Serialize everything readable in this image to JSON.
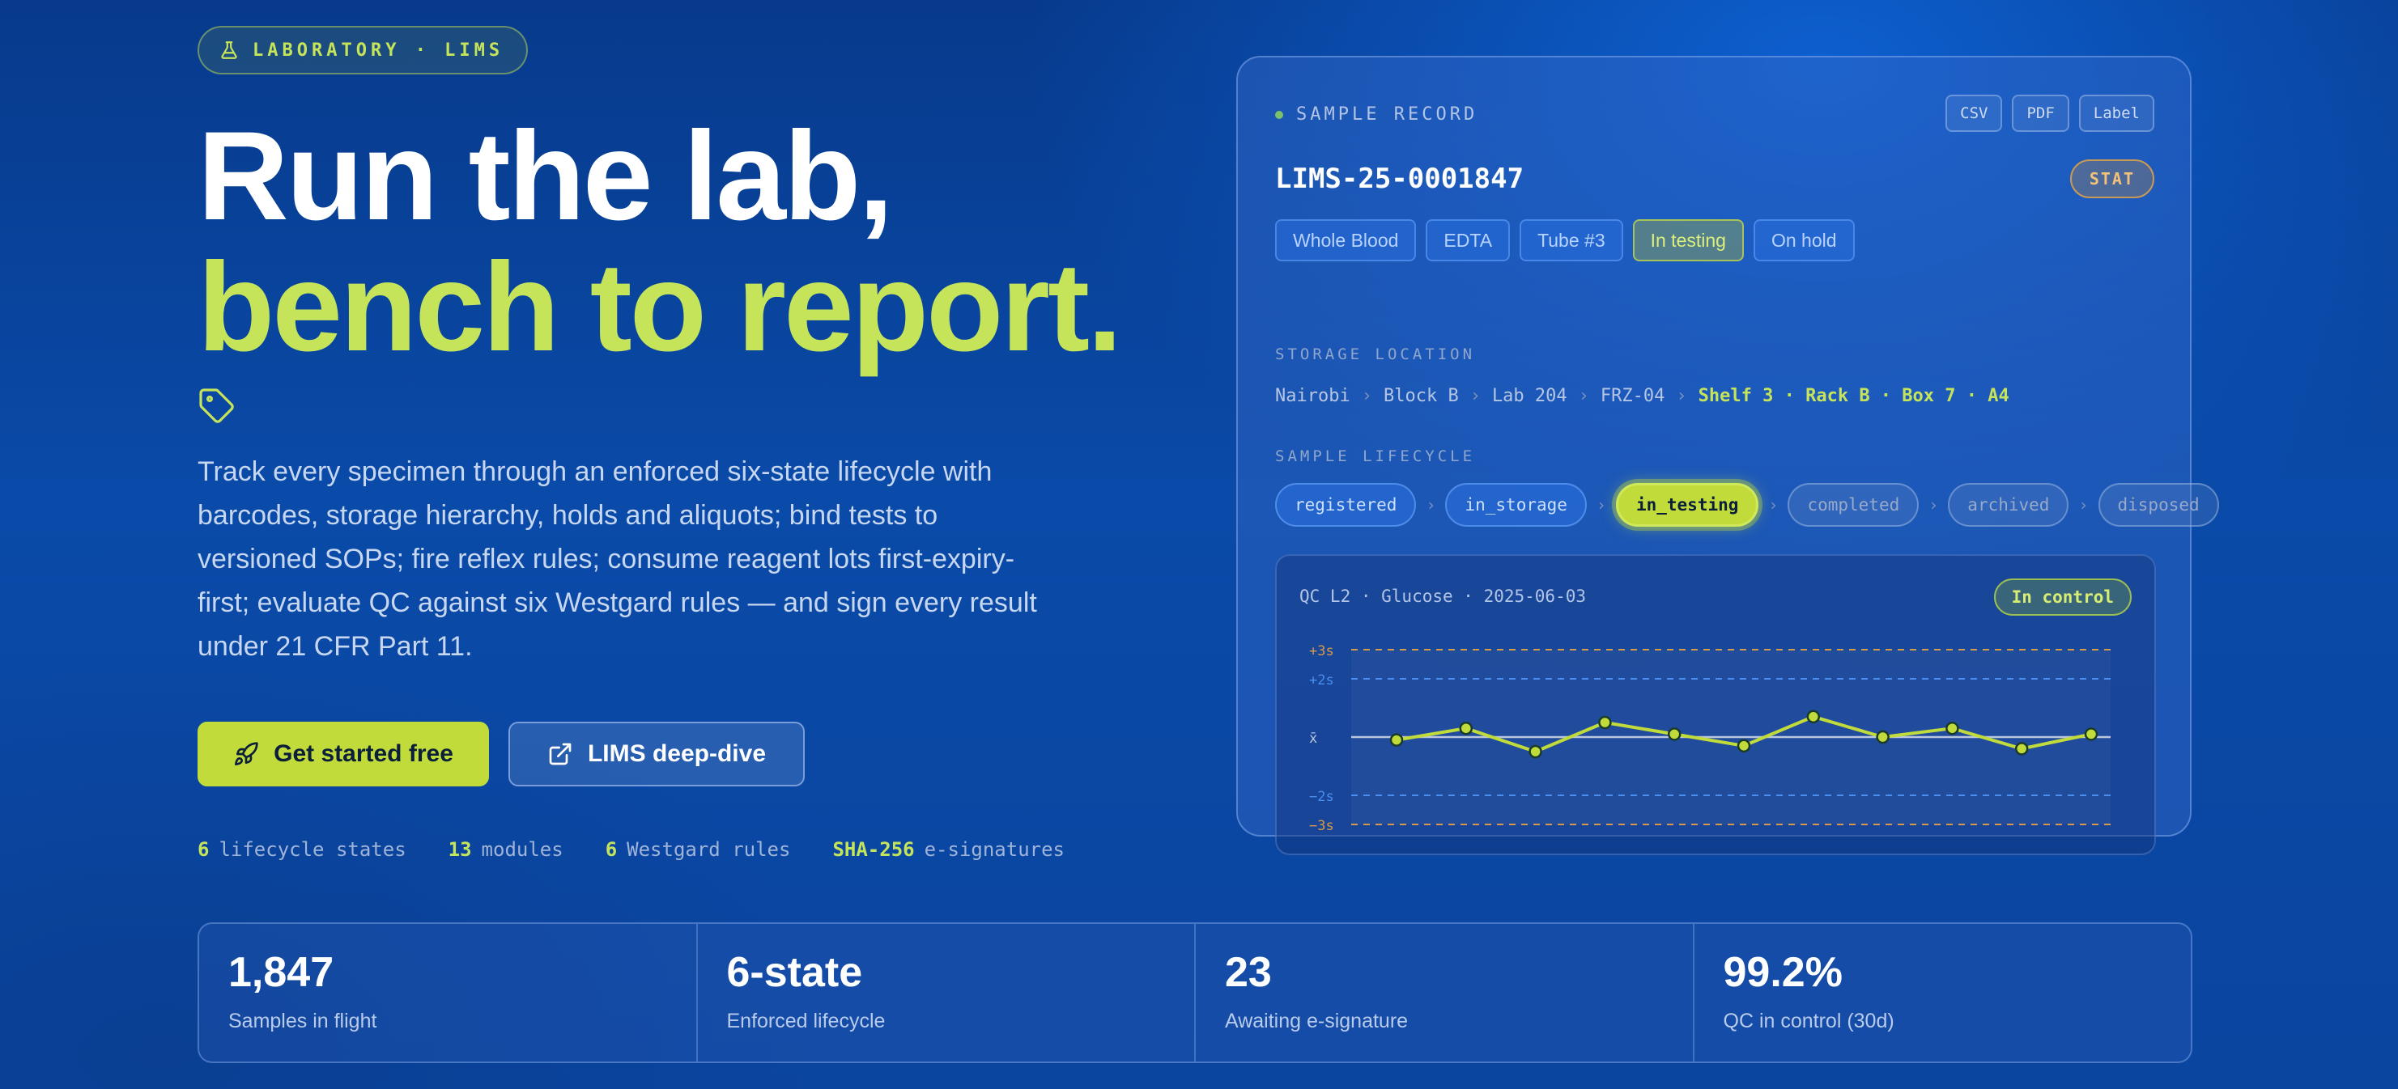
{
  "eyebrow": {
    "text": "LABORATORY · LIMS",
    "icon": "flask-icon"
  },
  "hero": {
    "line1": "Run the lab,",
    "line2": "bench to report."
  },
  "lead": "Track every specimen through an enforced six-state lifecycle with barcodes, storage hierarchy, holds and aliquots; bind tests to versioned SOPs; fire reflex rules; consume reagent lots first-expiry-first; evaluate QC against six Westgard rules — and sign every result under 21 CFR Part 11.",
  "buttons": {
    "primary": "Get started free",
    "secondary": "LIMS deep-dive"
  },
  "facts": [
    {
      "n": "6",
      "t": "lifecycle states"
    },
    {
      "n": "13",
      "t": "modules"
    },
    {
      "n": "6",
      "t": "Westgard rules"
    },
    {
      "n": "SHA-256",
      "t": "e-signatures"
    }
  ],
  "stats": [
    {
      "v": "1,847",
      "l": "Samples in flight"
    },
    {
      "v": "6-state",
      "l": "Enforced lifecycle"
    },
    {
      "v": "23",
      "l": "Awaiting e-signature"
    },
    {
      "v": "99.2%",
      "l": "QC in control (30d)"
    }
  ],
  "card": {
    "header": "SAMPLE RECORD",
    "actions": [
      "CSV",
      "PDF",
      "Label"
    ],
    "sample_id": "LIMS-25-0001847",
    "priority": "STAT",
    "chips": [
      "Whole Blood",
      "EDTA",
      "Tube #3",
      "In testing",
      "On hold"
    ],
    "storage_label": "STORAGE LOCATION",
    "storage": [
      "Nairobi",
      "Block B",
      "Lab 204",
      "FRZ-04"
    ],
    "storage_detail": "Shelf 3 · Rack B · Box 7 · A4",
    "lifecycle_label": "SAMPLE LIFECYCLE",
    "lifecycle": [
      {
        "s": "registered",
        "state": "done"
      },
      {
        "s": "in_storage",
        "state": "done"
      },
      {
        "s": "in_testing",
        "state": "cur"
      },
      {
        "s": "completed",
        "state": "todo"
      },
      {
        "s": "archived",
        "state": "todo"
      },
      {
        "s": "disposed",
        "state": "todo"
      }
    ],
    "qc_title": "QC L2 · Glucose · 2025-06-03",
    "qc_status": "In control"
  },
  "colors": {
    "accent": "#c1dc3a",
    "limit3s": "#d69a4a",
    "limit2s": "#4a8ef0",
    "mean": "#b9c6dd"
  },
  "chart_data": {
    "type": "line",
    "y_labels": [
      "+3s",
      "+2s",
      "x̄",
      "−2s",
      "−3s"
    ],
    "ylim": [
      -3,
      3
    ],
    "x": [
      1,
      2,
      3,
      4,
      5,
      6,
      7,
      8,
      9,
      10,
      11
    ],
    "series": [
      {
        "values": [
          -0.1,
          0.3,
          -0.5,
          0.5,
          0.1,
          -0.3,
          0.7,
          0.0,
          0.3,
          -0.4,
          0.1
        ]
      }
    ],
    "grid": false,
    "legend": "none"
  }
}
